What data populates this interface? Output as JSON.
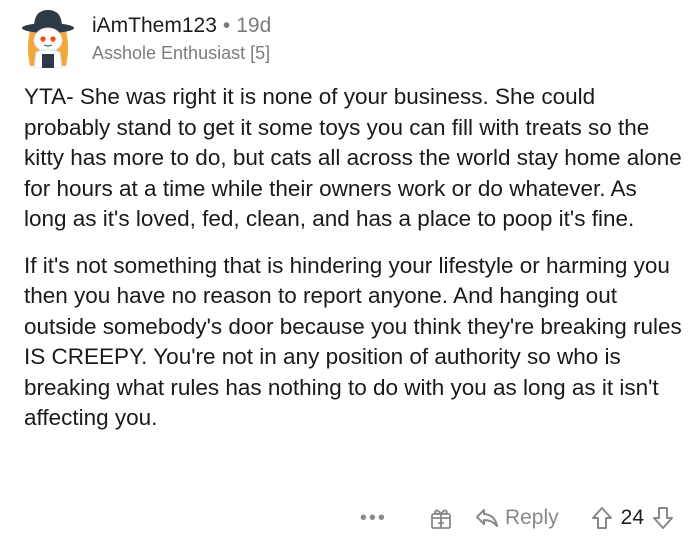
{
  "comment": {
    "username": "iAmThem123",
    "separator": "•",
    "age": "19d",
    "flair": "Asshole Enthusiast [5]",
    "paragraphs": [
      "YTA- She was right it is none of your business. She could probably stand to get it some toys you can fill with treats so the kitty has more to do, but cats all across the world stay home alone for hours at a time while their owners work or do whatever. As long as it's loved, fed, clean, and has a place to poop it's fine.",
      "If it's not something that is hindering your lifestyle or harming you then you have no reason to report anyone. And hanging out outside somebody's door because you think they're breaking rules IS CREEPY. You're not in any position of authority so who is breaking what rules has nothing to do with you as long as it isn't affecting you."
    ],
    "actions": {
      "more_label": "•••",
      "reply_label": "Reply",
      "vote_count": "24"
    },
    "icons": {
      "avatar": "snoo-avatar",
      "award": "award-gift-icon",
      "reply": "reply-arrow-icon",
      "upvote": "upvote-arrow-icon",
      "downvote": "downvote-arrow-icon"
    },
    "colors": {
      "meta_gray": "#7c7c7c",
      "action_gray": "#878a8c",
      "text": "#1a1a1b"
    }
  }
}
